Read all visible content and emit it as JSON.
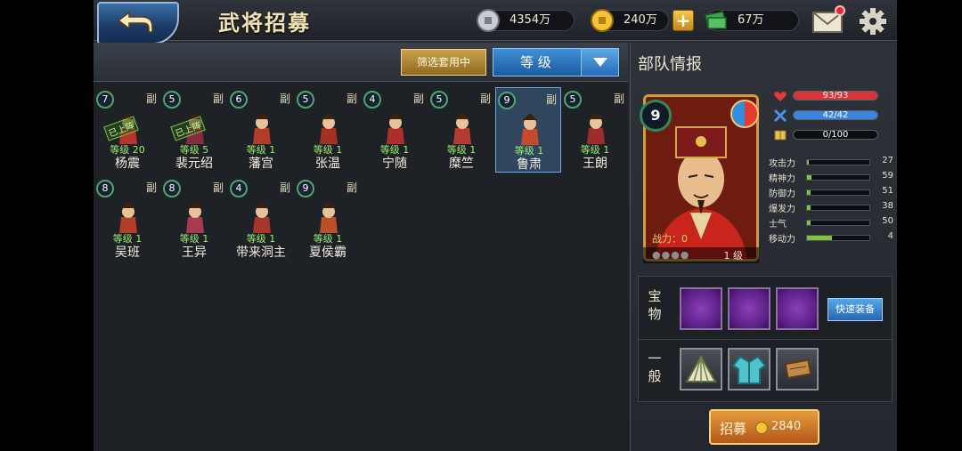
{
  "header": {
    "title": "武将招募",
    "resources": {
      "silver": "4354万",
      "gold": "240万",
      "cash": "67万"
    }
  },
  "filter": {
    "filter_button_label": "筛选套用中",
    "sort_selected": "等 级"
  },
  "generals": [
    {
      "name": "杨震",
      "star": "7",
      "tag": "副",
      "level_text": "等级 20",
      "stamp": "已上阵"
    },
    {
      "name": "裴元绍",
      "star": "5",
      "tag": "副",
      "level_text": "等级 5",
      "stamp": "已上阵"
    },
    {
      "name": "藩宫",
      "star": "6",
      "tag": "副",
      "level_text": "等级 1",
      "stamp": ""
    },
    {
      "name": "张温",
      "star": "5",
      "tag": "副",
      "level_text": "等级 1",
      "stamp": ""
    },
    {
      "name": "宁随",
      "star": "4",
      "tag": "副",
      "level_text": "等级 1",
      "stamp": ""
    },
    {
      "name": "糜竺",
      "star": "5",
      "tag": "副",
      "level_text": "等级 1",
      "stamp": ""
    },
    {
      "name": "鲁肃",
      "star": "9",
      "tag": "副",
      "level_text": "等级 1",
      "stamp": ""
    },
    {
      "name": "王朗",
      "star": "5",
      "tag": "副",
      "level_text": "等级 1",
      "stamp": ""
    },
    {
      "name": "吴班",
      "star": "8",
      "tag": "副",
      "level_text": "等级 1",
      "stamp": ""
    },
    {
      "name": "王异",
      "star": "8",
      "tag": "副",
      "level_text": "等级 1",
      "stamp": ""
    },
    {
      "name": "带来洞主",
      "star": "4",
      "tag": "副",
      "level_text": "等级 1",
      "stamp": ""
    },
    {
      "name": "夏侯霸",
      "star": "9",
      "tag": "副",
      "level_text": "等级 1",
      "stamp": ""
    }
  ],
  "selected_index": 6,
  "detail": {
    "panel_title": "部队情报",
    "star": "9",
    "power_text": "战力：0",
    "grade_text": "1 级",
    "hp_text": "93/93",
    "mp_text": "42/42",
    "exp_text": "0/100",
    "hp_fraction": 1.0,
    "mp_fraction": 1.0,
    "exp_fraction": 0.0,
    "stats": [
      {
        "name": "攻击力",
        "value": "27"
      },
      {
        "name": "精神力",
        "value": "59"
      },
      {
        "name": "防御力",
        "value": "51"
      },
      {
        "name": "爆发力",
        "value": "38"
      },
      {
        "name": "士气",
        "value": "50"
      },
      {
        "name": "移动力",
        "value": "4"
      }
    ],
    "stat_fractions": [
      0.03,
      0.07,
      0.06,
      0.05,
      0.06,
      0.4
    ],
    "equip": {
      "treasure_label": "宝物",
      "general_label": "一般",
      "quick_equip_label": "快速装备"
    },
    "recruit": {
      "label": "招募",
      "cost": "2840"
    }
  },
  "colors": {
    "hp": "#d8343a",
    "mp": "#3d86e0",
    "exp": "#d6b64a",
    "stat": "#7cc33e"
  }
}
